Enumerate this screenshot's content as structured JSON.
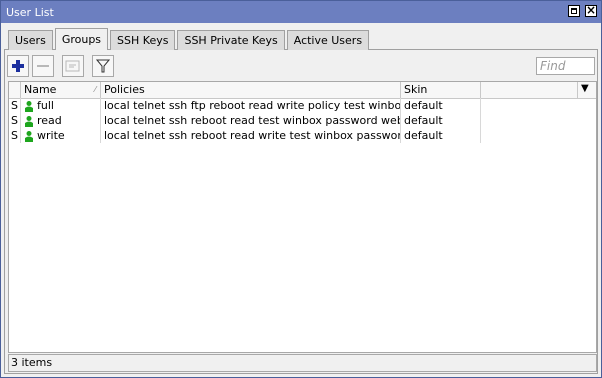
{
  "window": {
    "title": "User List"
  },
  "tabs": [
    {
      "label": "Users",
      "active": false
    },
    {
      "label": "Groups",
      "active": true
    },
    {
      "label": "SSH Keys",
      "active": false
    },
    {
      "label": "SSH Private Keys",
      "active": false
    },
    {
      "label": "Active Users",
      "active": false
    }
  ],
  "toolbar": {
    "add_icon": "plus-icon",
    "remove_icon": "minus-icon",
    "comment_icon": "comment-icon",
    "filter_icon": "filter-icon",
    "find_placeholder": "Find"
  },
  "table": {
    "columns": [
      "Name",
      "Policies",
      "Skin"
    ],
    "rows": [
      {
        "flag": "S",
        "name": "full",
        "policies": "local telnet ssh ftp reboot read write policy test winbox passw...",
        "skin": "default"
      },
      {
        "flag": "S",
        "name": "read",
        "policies": "local telnet ssh reboot read test winbox password web sniff s...",
        "skin": "default"
      },
      {
        "flag": "S",
        "name": "write",
        "policies": "local telnet ssh reboot read write test winbox password web ...",
        "skin": "default"
      }
    ]
  },
  "status": {
    "count": "3 items"
  },
  "colors": {
    "titlebar": "#6c7fc0",
    "plus": "#1c2f9e",
    "user_icon": "#1ea61e"
  }
}
